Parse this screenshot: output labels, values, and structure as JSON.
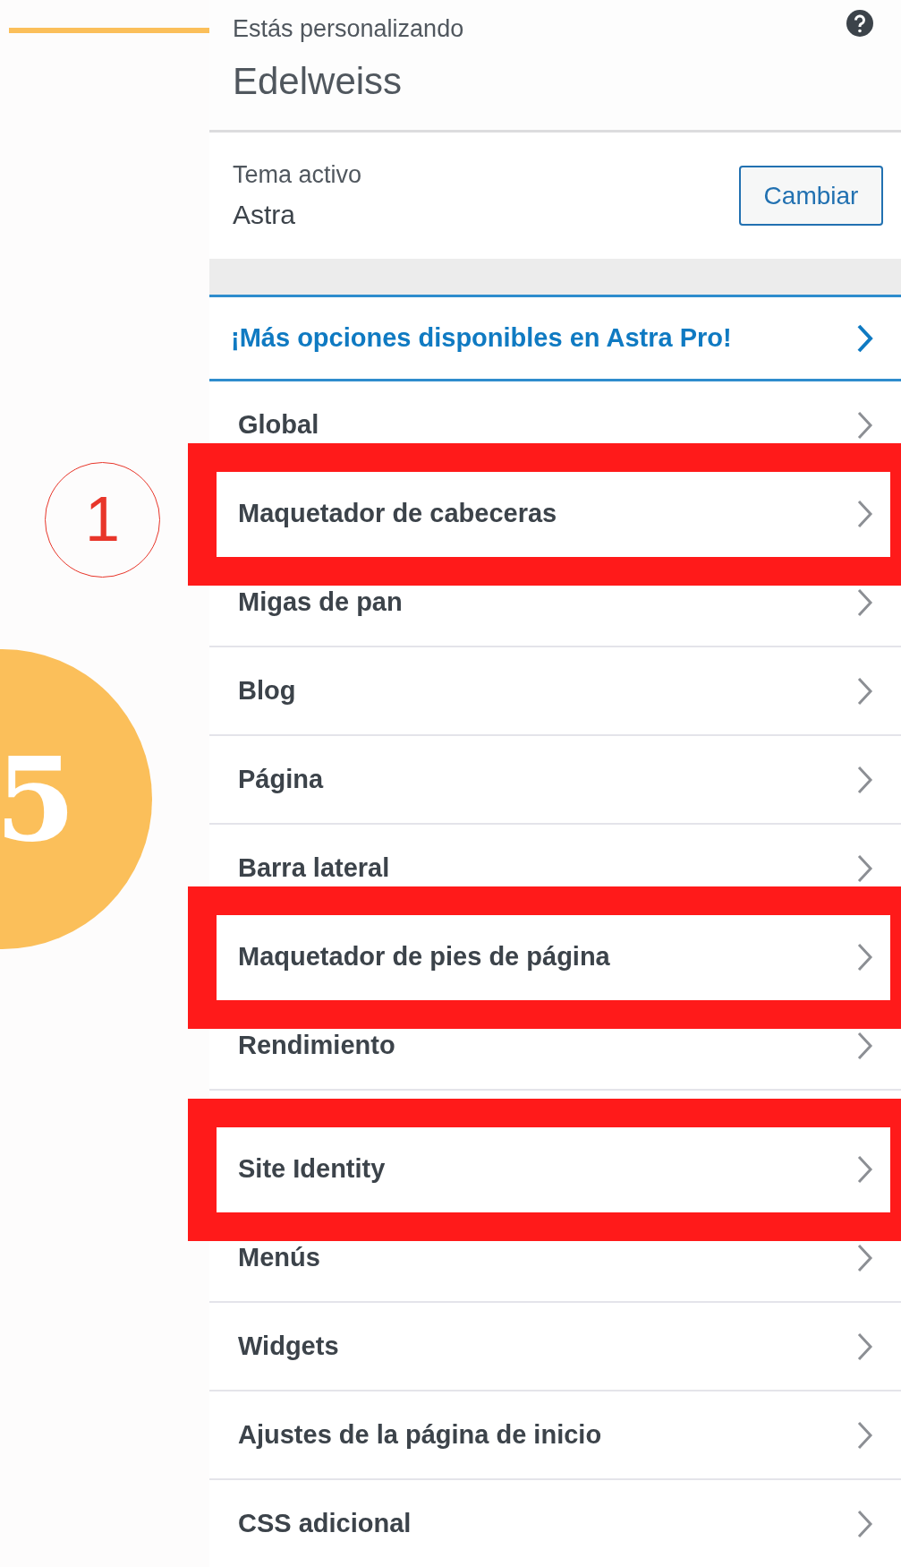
{
  "header": {
    "subtitle": "Estás personalizando",
    "title": "Edelweiss"
  },
  "theme": {
    "label": "Tema activo",
    "name": "Astra",
    "button": "Cambiar"
  },
  "promo": {
    "label": "¡Más opciones disponibles en Astra Pro!"
  },
  "annotations": {
    "step": "1",
    "number": "5"
  },
  "menu_groups": [
    {
      "items": [
        {
          "label": "Global",
          "highlighted": false
        },
        {
          "label": "Maquetador de cabeceras",
          "highlighted": true
        },
        {
          "label": "Migas de pan",
          "highlighted": false
        },
        {
          "label": "Blog",
          "highlighted": false
        },
        {
          "label": "Página",
          "highlighted": false
        },
        {
          "label": "Barra lateral",
          "highlighted": false
        },
        {
          "label": "Maquetador de pies de página",
          "highlighted": true
        },
        {
          "label": "Rendimiento",
          "highlighted": false
        }
      ]
    },
    {
      "items": [
        {
          "label": "Site Identity",
          "highlighted": true
        },
        {
          "label": "Menús",
          "highlighted": false
        },
        {
          "label": "Widgets",
          "highlighted": false
        },
        {
          "label": "Ajustes de la página de inicio",
          "highlighted": false
        },
        {
          "label": "CSS adicional",
          "highlighted": false
        }
      ]
    }
  ]
}
